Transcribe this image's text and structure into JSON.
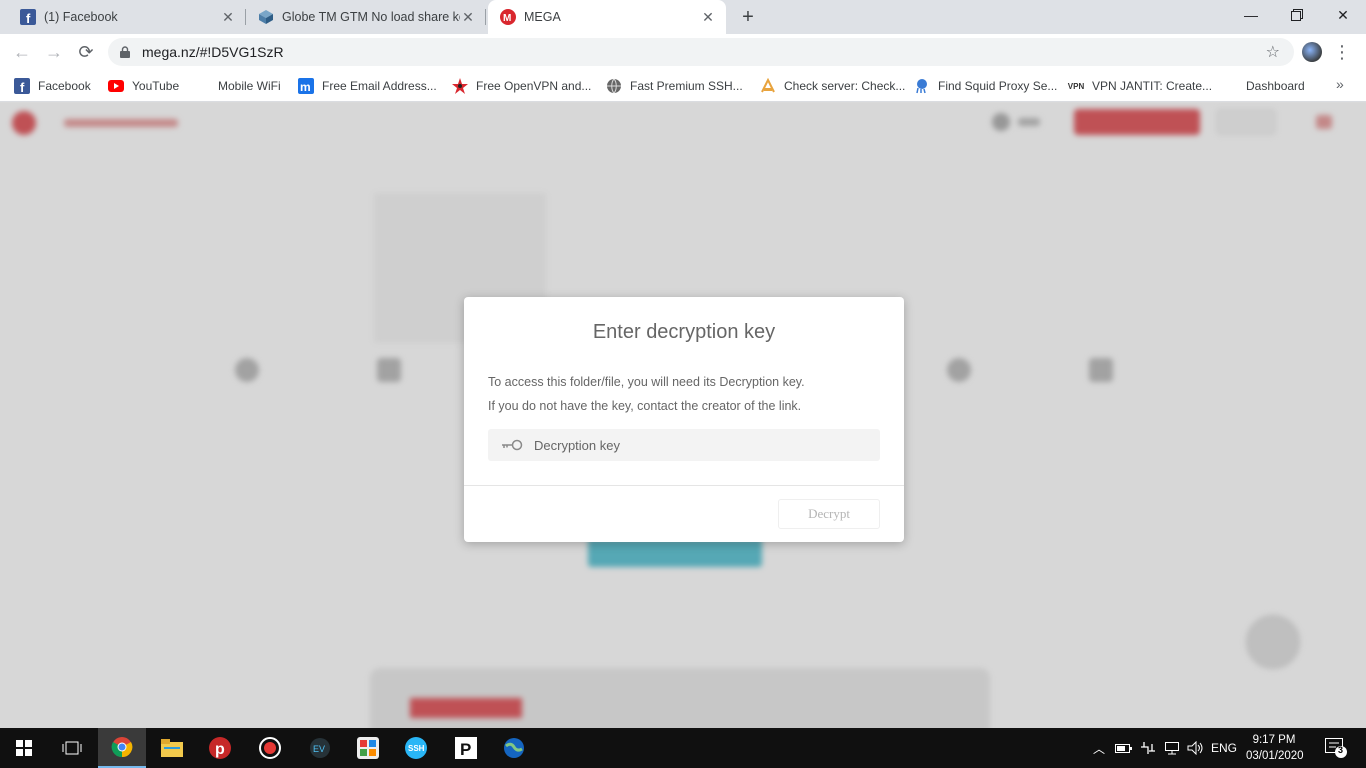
{
  "tabs": [
    {
      "title": "(1) Facebook"
    },
    {
      "title": "Globe TM GTM No load share ko"
    },
    {
      "title": "MEGA"
    }
  ],
  "address_bar": {
    "url": "mega.nz/#!D5VG1SzR"
  },
  "bookmarks": [
    {
      "label": "Facebook",
      "icon": "facebook-icon"
    },
    {
      "label": "YouTube",
      "icon": "youtube-icon"
    },
    {
      "label": "Mobile WiFi",
      "icon": "blank-icon"
    },
    {
      "label": "Free Email Address...",
      "icon": "m-icon"
    },
    {
      "label": "Free OpenVPN and...",
      "icon": "vpn-star-icon"
    },
    {
      "label": "Fast Premium SSH...",
      "icon": "globe-icon"
    },
    {
      "label": "Check server: Check...",
      "icon": "server-icon"
    },
    {
      "label": "Find Squid Proxy Se...",
      "icon": "squid-icon"
    },
    {
      "label": "VPN JANTIT: Create...",
      "icon": "vpn-icon"
    },
    {
      "label": "Dashboard",
      "icon": "blank-icon"
    }
  ],
  "bookmark_vpn_badge": "VPN",
  "modal": {
    "title": "Enter decryption key",
    "line1": "To access this folder/file, you will need its Decryption key.",
    "line2": "If you do not have the key, contact the creator of the link.",
    "key_placeholder": "Decryption key",
    "decrypt_label": "Decrypt"
  },
  "taskbar": {
    "language": "ENG",
    "time": "9:17 PM",
    "date": "03/01/2020",
    "notification_count": "3"
  },
  "colors": {
    "mega_red": "#d9272e",
    "teal": "#2fb3c8",
    "taskbar": "#101010"
  }
}
